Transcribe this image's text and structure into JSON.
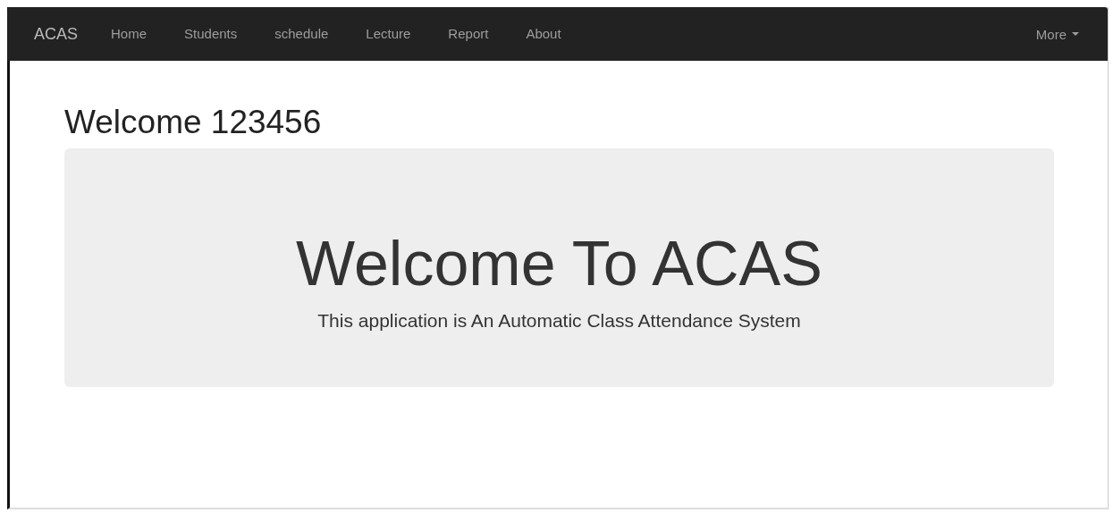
{
  "navbar": {
    "brand": "ACAS",
    "items": [
      {
        "label": "Home",
        "selected": false
      },
      {
        "label": "Students",
        "selected": false
      },
      {
        "label": "schedule",
        "selected": false
      },
      {
        "label": "Lecture",
        "selected": false
      },
      {
        "label": "Report",
        "selected": false
      },
      {
        "label": "About",
        "selected": false
      }
    ],
    "dropdown": {
      "label": "More"
    }
  },
  "greeting": "Welcome 123456",
  "jumbotron": {
    "heading": "Welcome To ACAS",
    "text": "This application is An Automatic Class Attendance System"
  }
}
